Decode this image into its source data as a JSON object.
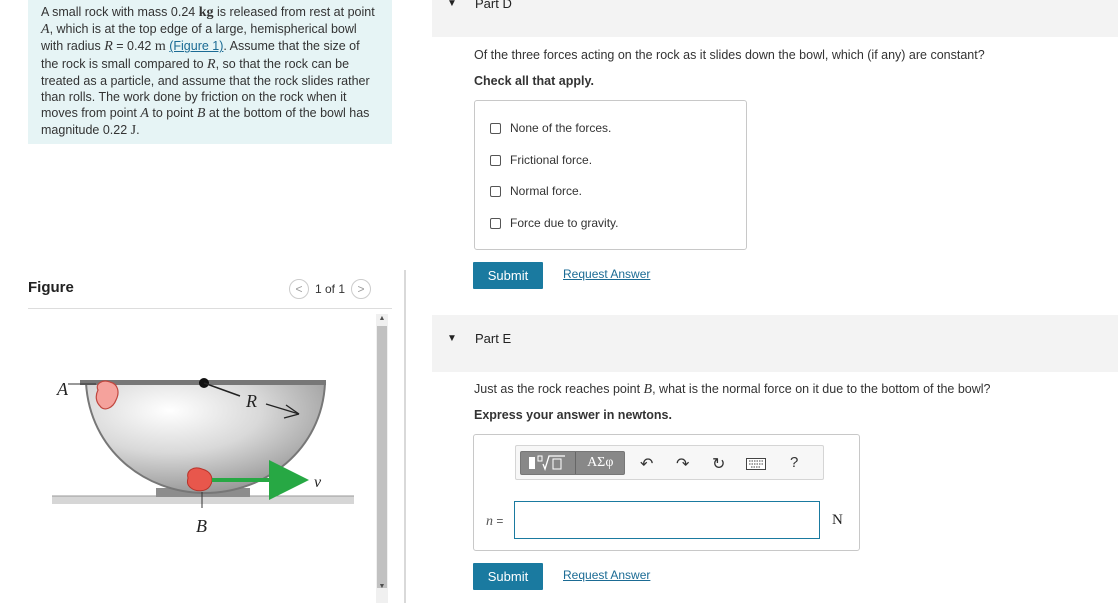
{
  "problem": {
    "t1": "A small rock with mass 0.24 ",
    "kg": "kg",
    "t2": " is released from rest at point ",
    "A": "A",
    "t3": ", which is at the top edge of a large, hemispherical bowl with radius ",
    "R": "R",
    "t4": " = 0.42 ",
    "m": "m",
    "t5": " ",
    "fig_link": "(Figure 1)",
    "t6": ". Assume that the size of the rock is small compared to ",
    "R2": "R",
    "t7": ", so that the rock can be treated as a particle, and assume that the rock slides rather than rolls. The work done by friction on the rock when it moves from point ",
    "A2": "A",
    "t8": " to point ",
    "B": "B",
    "t9": " at the bottom of the bowl has magnitude 0.22 ",
    "J": "J",
    "t10": "."
  },
  "figure": {
    "header": "Figure",
    "pager": "1 of 1",
    "prev_icon": "<",
    "next_icon": ">",
    "label_A": "A",
    "label_B": "B",
    "label_R": "R",
    "label_v": "v"
  },
  "partD": {
    "title": "Part D",
    "question": "Of the three forces acting on the rock as it slides down the bowl, which (if any) are constant?",
    "instruction": "Check all that apply.",
    "options": [
      "None of the forces.",
      "Frictional force.",
      "Normal force.",
      "Force due to gravity."
    ],
    "submit": "Submit",
    "request": "Request Answer"
  },
  "partE": {
    "title": "Part E",
    "q1": "Just as the rock reaches point ",
    "qB": "B",
    "q2": ", what is the normal force on it due to the bottom of the bowl?",
    "instruction": "Express your answer in newtons.",
    "toolbar_symbols": "ΑΣφ",
    "help": "?",
    "var_label": "n",
    "eq": " =",
    "unit": "N",
    "submit": "Submit",
    "request": "Request Answer"
  },
  "colors": {
    "accent": "#1a7aa0",
    "link": "#1b6b94",
    "problem_bg": "#e6f4f5",
    "rock": "#e8574c",
    "velocity_arrow": "#27a844"
  }
}
